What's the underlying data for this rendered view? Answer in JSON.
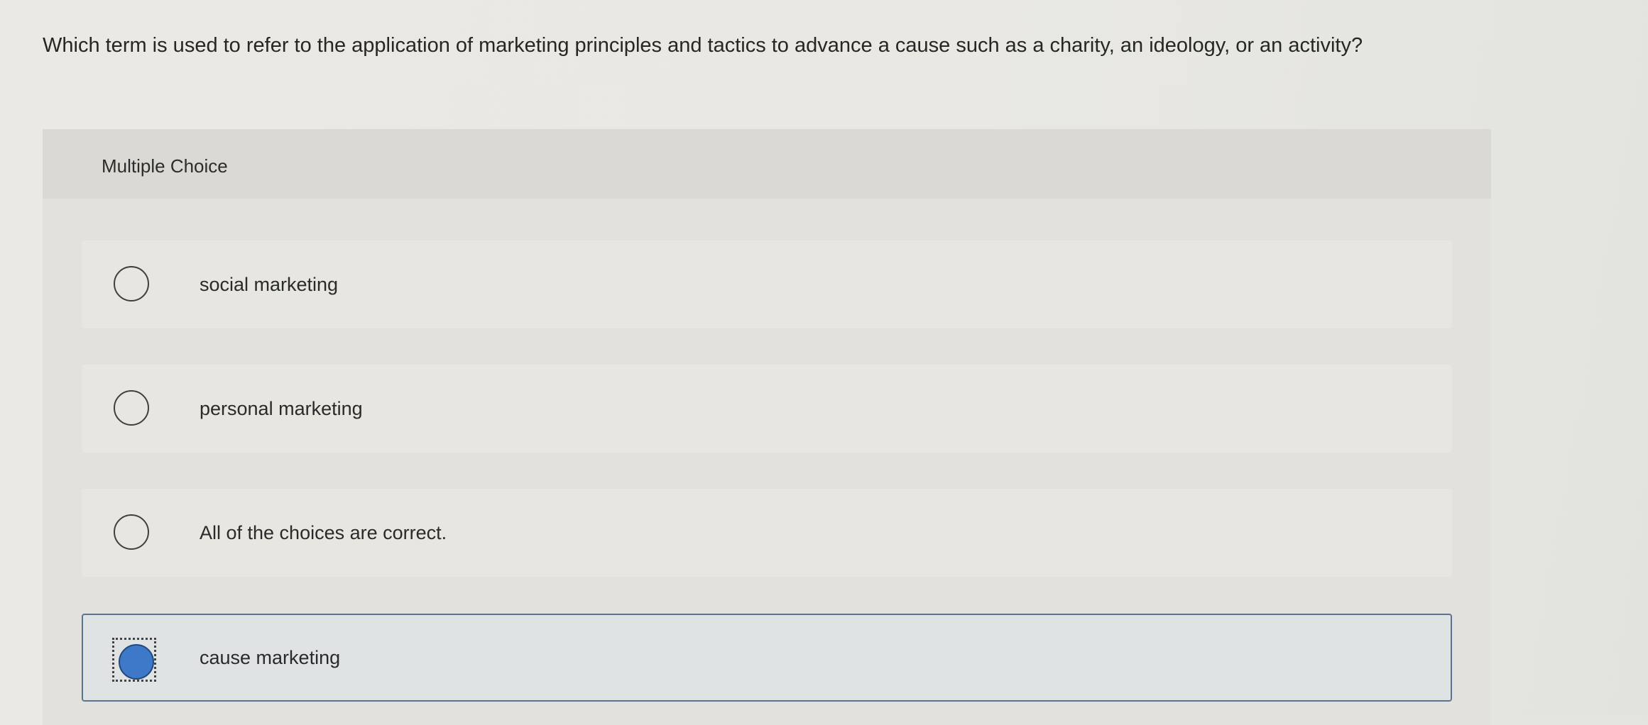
{
  "question": {
    "text": "Which term is used to refer to the application of marketing principles and tactics to advance a cause such as a charity, an ideology, or an activity?"
  },
  "panel": {
    "title": "Multiple Choice"
  },
  "options": [
    {
      "label": "social marketing",
      "selected": false
    },
    {
      "label": "personal marketing",
      "selected": false
    },
    {
      "label": "All of the choices are correct.",
      "selected": false
    },
    {
      "label": "cause marketing",
      "selected": true
    }
  ],
  "colors": {
    "selected_fill": "#3e78c8",
    "selected_border": "#5a7393"
  }
}
